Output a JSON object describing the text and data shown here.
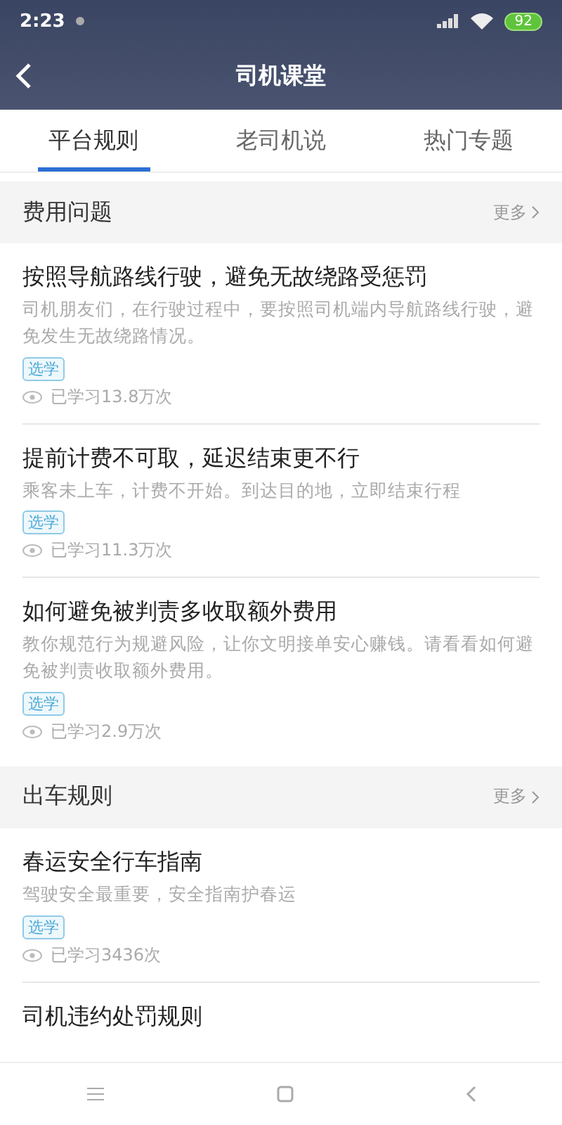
{
  "status_bar": {
    "time": "2:23",
    "battery": "92"
  },
  "header": {
    "title": "司机课堂"
  },
  "tabs": [
    {
      "label": "平台规则",
      "selected": true
    },
    {
      "label": "老司机说",
      "selected": false
    },
    {
      "label": "热门专题",
      "selected": false
    }
  ],
  "sections": [
    {
      "title": "费用问题",
      "more": "更多",
      "items": [
        {
          "title": "按照导航路线行驶，避免无故绕路受惩罚",
          "desc": "司机朋友们，在行驶过程中，要按照司机端内导航路线行驶，避免发生无故绕路情况。",
          "tag": "选学",
          "views": "已学习13.8万次"
        },
        {
          "title": "提前计费不可取，延迟结束更不行",
          "desc": "乘客未上车，计费不开始。到达目的地，立即结束行程",
          "tag": "选学",
          "views": "已学习11.3万次"
        },
        {
          "title": "如何避免被判责多收取额外费用",
          "desc": "教你规范行为规避风险，让你文明接单安心赚钱。请看看如何避免被判责收取额外费用。",
          "tag": "选学",
          "views": "已学习2.9万次"
        }
      ]
    },
    {
      "title": "出车规则",
      "more": "更多",
      "items": [
        {
          "title": "春运安全行车指南",
          "desc": "驾驶安全最重要，安全指南护春运",
          "tag": "选学",
          "views": "已学习3436次"
        },
        {
          "title": "司机违约处罚规则"
        }
      ]
    }
  ]
}
